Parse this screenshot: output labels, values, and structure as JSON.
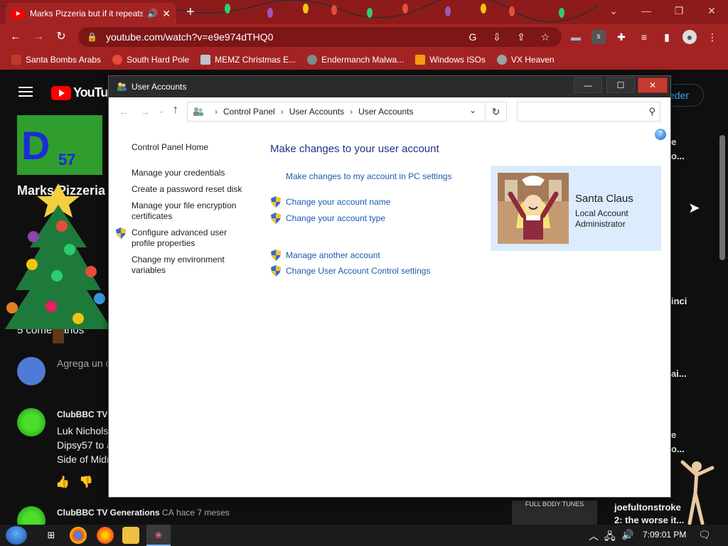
{
  "browser": {
    "tab_title": "Marks Pizzeria but if it repeats",
    "url": "youtube.com/watch?v=e9e974dTHQ0",
    "bookmarks": [
      {
        "label": "Santa Bombs Arabs",
        "color": "#c0392b"
      },
      {
        "label": "South Hard Pole",
        "color": "#e74c3c"
      },
      {
        "label": "MEMZ Christmas E...",
        "color": "#bdc3c7"
      },
      {
        "label": "Endermanch Malwa...",
        "color": "#7f8c8d"
      },
      {
        "label": "Windows ISOs",
        "color": "#f39c12"
      },
      {
        "label": "VX Heaven",
        "color": "#95a5a6"
      }
    ]
  },
  "youtube": {
    "logo": "YouTub",
    "signin": "eder",
    "thumb_letter": "D",
    "thumb_number": "57",
    "video_title": "Marks Pizzeria",
    "comments_count": "5 comentarios",
    "add_comment": "Agrega un c",
    "comment1": {
      "author": "ClubBBC TV",
      "lines": [
        "Luk Nichols",
        "Dipsy57 to a",
        "Side of Midn"
      ]
    },
    "comment2": {
      "author": "ClubBBC TV Generations",
      "badge": "CA",
      "time": "hace 7 meses"
    },
    "right_snippets": [
      "e",
      "o...",
      "inci",
      "ai...",
      "e",
      "o..."
    ],
    "sugg_title": "joefultonstroke",
    "sugg_sub": "2: the worse it...",
    "sugg_thumb_text": "FULL BODY TUNES"
  },
  "window": {
    "title": "User Accounts",
    "breadcrumb": [
      "Control Panel",
      "User Accounts",
      "User Accounts"
    ],
    "left_pane": {
      "home": "Control Panel Home",
      "items": [
        "Manage your credentials",
        "Create a password reset disk",
        "Manage your file encryption certificates",
        "Configure advanced user profile properties",
        "Change my environment variables"
      ]
    },
    "main": {
      "title": "Make changes to your user account",
      "links": [
        "Make changes to my account in PC settings",
        "Change your account name",
        "Change your account type",
        "Manage another account",
        "Change User Account Control settings"
      ]
    },
    "account": {
      "name": "Santa Claus",
      "type": "Local Account",
      "role": "Administrator"
    }
  },
  "taskbar": {
    "clock": "7:09:01 PM"
  },
  "colors": {
    "chrome_bg": "#a32323",
    "link": "#1e58b4",
    "title_blue": "#1e3287",
    "card_bg": "#dcecfc"
  }
}
